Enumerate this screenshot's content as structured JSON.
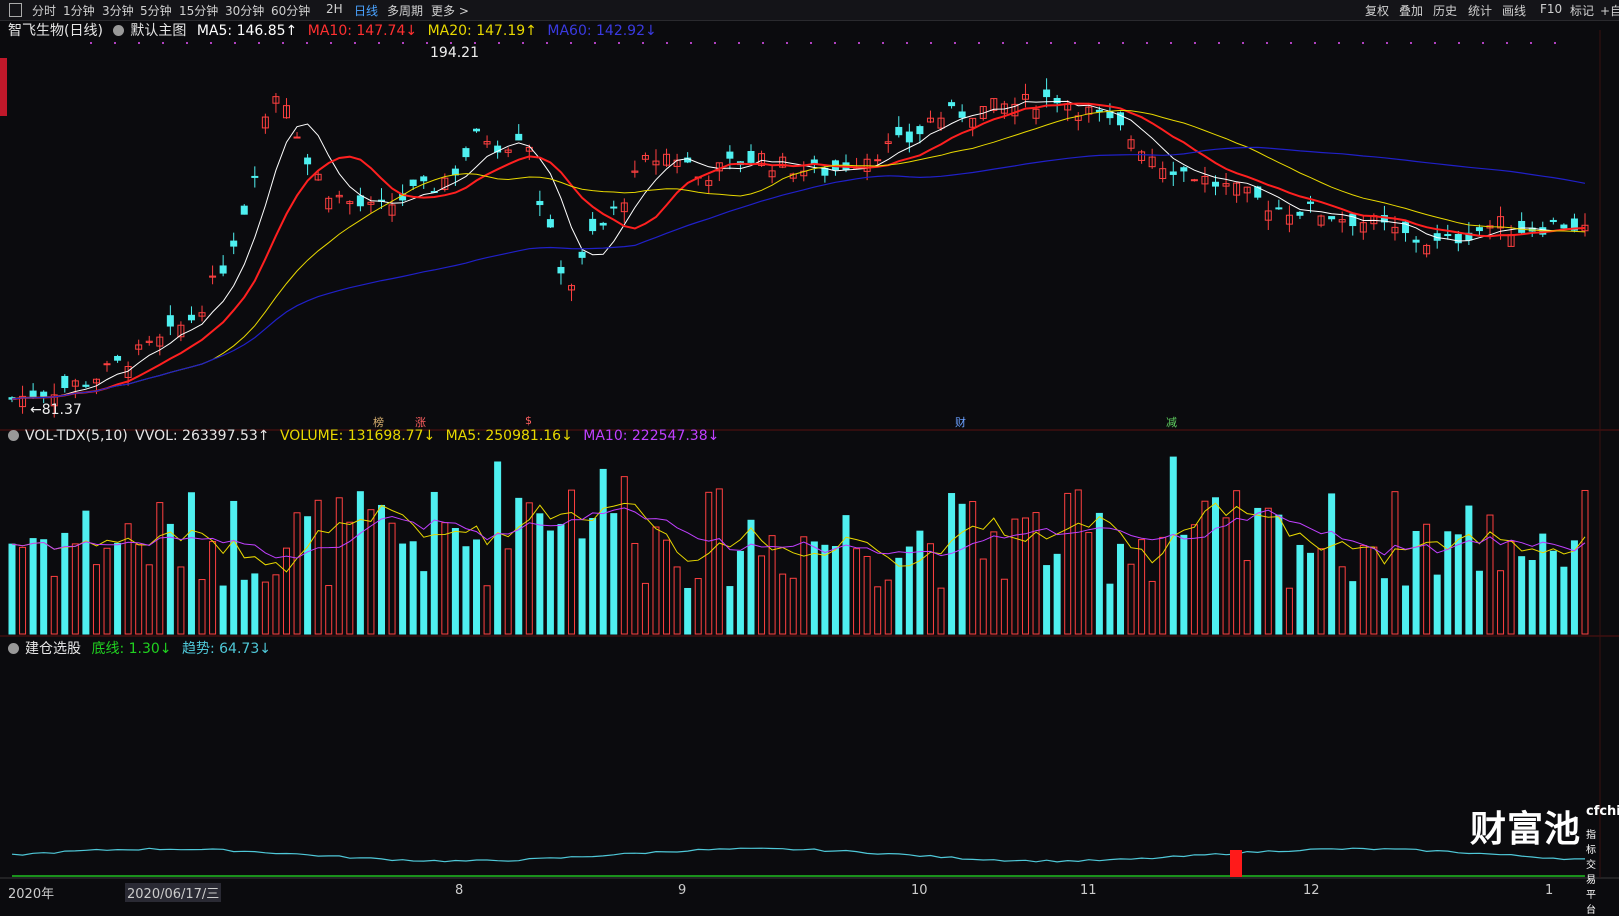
{
  "toolbar": {
    "periods": [
      "分时",
      "1分钟",
      "3分钟",
      "5分钟",
      "15分钟",
      "30分钟",
      "60分钟",
      "2H",
      "日线",
      "多周期",
      "更多 >"
    ],
    "active": "日线",
    "right_tools": [
      "复权",
      "叠加",
      "历史",
      "统计",
      "画线",
      "F10",
      "标记",
      "+自"
    ]
  },
  "main": {
    "stock": "智飞生物(日线)",
    "template": "默认主图",
    "ma5": "MA5: 146.85↑",
    "ma10": "MA10: 147.74↓",
    "ma20": "MA20: 147.19↑",
    "ma60": "MA60: 142.92↓",
    "high_label": "194.21",
    "low_label": "←81.37"
  },
  "volume": {
    "name": "VOL-TDX(5,10)",
    "vvol": "VVOL: 263397.53↑",
    "volume": "VOLUME: 131698.77↓",
    "ma5": "MA5: 250981.16↓",
    "ma10": "MA10: 222547.38↓"
  },
  "indicator": {
    "name": "建仓选股",
    "base": "底线: 1.30↓",
    "trend": "趋势: 64.73↓"
  },
  "xaxis": {
    "year": "2020年",
    "cursor_date": "2020/06/17/三",
    "months": [
      "8",
      "9",
      "10",
      "11",
      "12",
      "1"
    ]
  },
  "signals": [
    "榜",
    "涨",
    "$",
    "财",
    "减"
  ],
  "logo": {
    "name": "财富池",
    "domain": "cfchi.com",
    "sub": "指标交易平台"
  },
  "colors": {
    "up": "#ff4040",
    "down": "#4ff0f0",
    "ma5": "#ffffff",
    "ma10": "#ff2020",
    "ma20": "#e8d800",
    "ma60": "#2020c8",
    "vma5": "#e8d800",
    "vma10": "#c040ff",
    "trend": "#4fc8d8",
    "base": "#20c020"
  },
  "chart_data": {
    "type": "candlestick",
    "price_high": 194.21,
    "price_low": 81.37,
    "months": [
      "8",
      "9",
      "10",
      "11",
      "12",
      "1"
    ]
  }
}
